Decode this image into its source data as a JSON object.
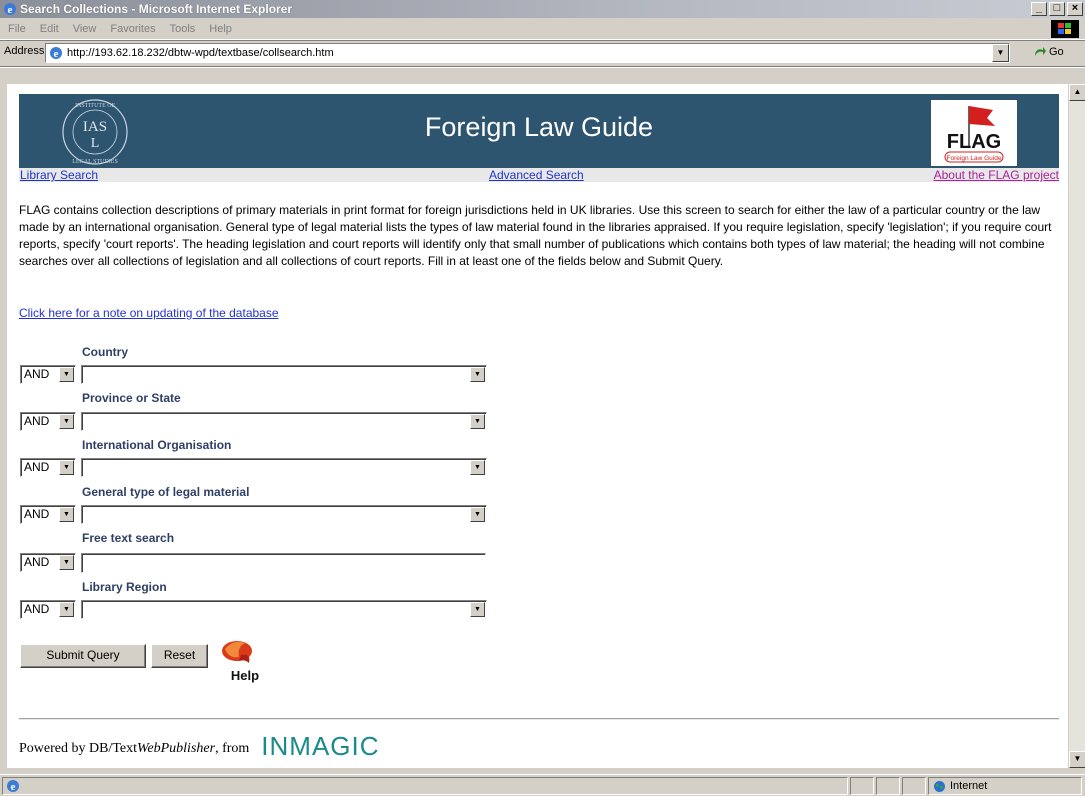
{
  "window": {
    "title": "Search Collections - Microsoft Internet Explorer",
    "minimize": "_",
    "maximize": "□",
    "close": "×"
  },
  "menu": [
    "File",
    "Edit",
    "View",
    "Favorites",
    "Tools",
    "Help"
  ],
  "address": {
    "label": "Address",
    "url": "http://193.62.18.232/dbtw-wpd/textbase/collsearch.htm",
    "go": "Go"
  },
  "banner": {
    "title": "Foreign Law Guide",
    "left_logo_text": "IALS",
    "right_logo_text": "FLAG",
    "right_logo_sub": "Foreign Law Guide"
  },
  "nav": {
    "library_search": "Library Search",
    "advanced_search": "Advanced Search",
    "about": "About the FLAG project"
  },
  "description": "FLAG contains collection descriptions of primary materials in print format for foreign jurisdictions held in UK libraries. Use this screen to search for either the law of a particular country or the law made by an international organisation. General type of legal material lists the types of law material found in the libraries appraised. If you require legislation, specify 'legislation'; if you require court reports, specify 'court reports'. The heading legislation and court reports will identify only that small number of publications which contains both types of law material; the heading will not combine searches over all collections of legislation and all collections of court reports. Fill in at least one of the fields below and Submit Query.",
  "note_link": "Click here for a note on updating of the database",
  "form": {
    "bool_value": "AND",
    "fields": [
      {
        "label": "Country",
        "type": "select",
        "value": ""
      },
      {
        "label": "Province or State",
        "type": "select",
        "value": ""
      },
      {
        "label": "International Organisation",
        "type": "select",
        "value": ""
      },
      {
        "label": "General type of legal material",
        "type": "select",
        "value": ""
      },
      {
        "label": "Free text search",
        "type": "text",
        "value": ""
      },
      {
        "label": "Library Region",
        "type": "select",
        "value": ""
      }
    ],
    "submit": "Submit Query",
    "reset": "Reset",
    "help": "Help"
  },
  "footer": {
    "powered_prefix": "Powered by DB/Text ",
    "product": "WebPublisher",
    "from": ", from",
    "vendor": "INMAGIC"
  },
  "status": {
    "zone": "Internet"
  },
  "colors": {
    "banner": "#2e5570",
    "link": "#2233cc",
    "visited_link": "#aa2299",
    "label": "#2e3f66"
  }
}
